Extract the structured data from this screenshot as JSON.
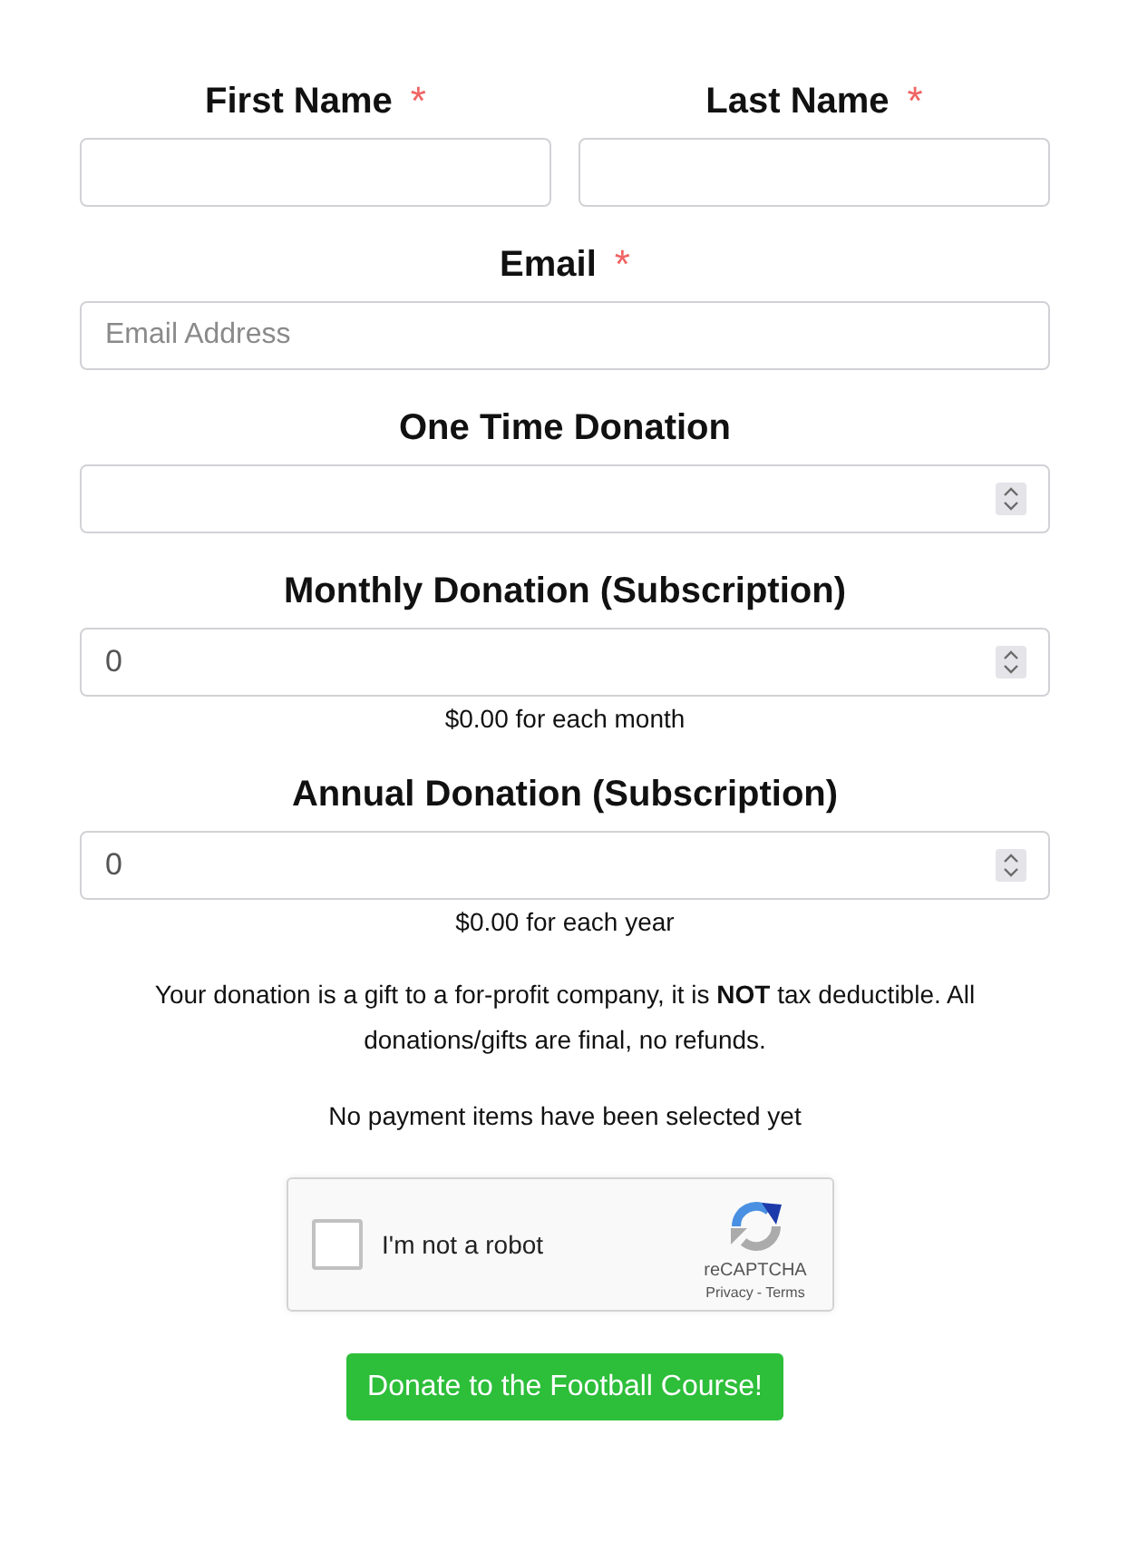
{
  "name_fields": [
    {
      "label": "First Name",
      "required_mark": "*"
    },
    {
      "label": "Last Name",
      "required_mark": "*"
    }
  ],
  "email_field": {
    "label": "Email",
    "required_mark": "*",
    "placeholder": "Email Address"
  },
  "donation_fields": [
    {
      "label": "One Time Donation"
    },
    {
      "label": "Monthly Donation (Subscription)",
      "value": "0",
      "note": "$0.00 for each month"
    },
    {
      "label": "Annual Donation (Subscription)",
      "value": "0",
      "note": "$0.00 for each year"
    }
  ],
  "disclaimer": "Your donation is a gift to a for-profit company, it is **NOT** tax deductible. All donations/gifts are final, no refunds.",
  "status": "No payment items have been selected yet",
  "captcha": {
    "label": "I'm not a robot",
    "checked": false,
    "brand": "reCAPTCHA",
    "links": [
      "Privacy",
      "Terms"
    ],
    "link_separator": "-"
  },
  "submit_button": "Donate to the Football Course!"
}
